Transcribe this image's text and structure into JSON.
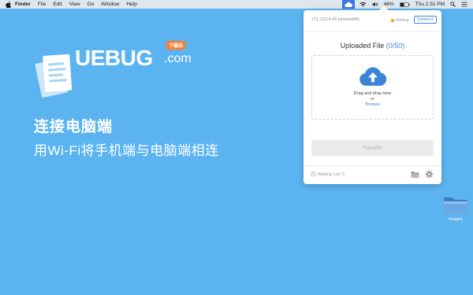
{
  "menubar": {
    "app_name": "Finder",
    "items": [
      "File",
      "Edit",
      "View",
      "Go",
      "Window",
      "Help"
    ],
    "battery": "46%",
    "clock": "Thu 2:31 PM",
    "icons": [
      "apple-icon",
      "uebug-tray-icon",
      "wifi-icon",
      "volume-icon",
      "battery-icon",
      "search-icon",
      "list-icon"
    ]
  },
  "hero": {
    "brand_text": "UEBUG",
    "brand_badge": "下载站",
    "brand_suffix": ".com",
    "title": "连接电脑端",
    "subtitle": "用Wi-Fi将手机端与电脑端相连"
  },
  "panel": {
    "ip_text": "171.123.4.49 (HomeWifi)",
    "status": "Waiting",
    "connect_label": "Connect",
    "uploaded_label": "Uploaded File",
    "uploaded_count": "(0/50)",
    "drop_text": "Drag and drop here",
    "or_text": "or",
    "browse_label": "Browse",
    "transfer_label": "Transfer",
    "waiting_list_label": "Waiting List: 0"
  },
  "desktop": {
    "folder_label": "Images"
  },
  "colors": {
    "desktop_bg": "#5bb4f0",
    "accent": "#3c84d8",
    "status_waiting": "#f5a623"
  }
}
